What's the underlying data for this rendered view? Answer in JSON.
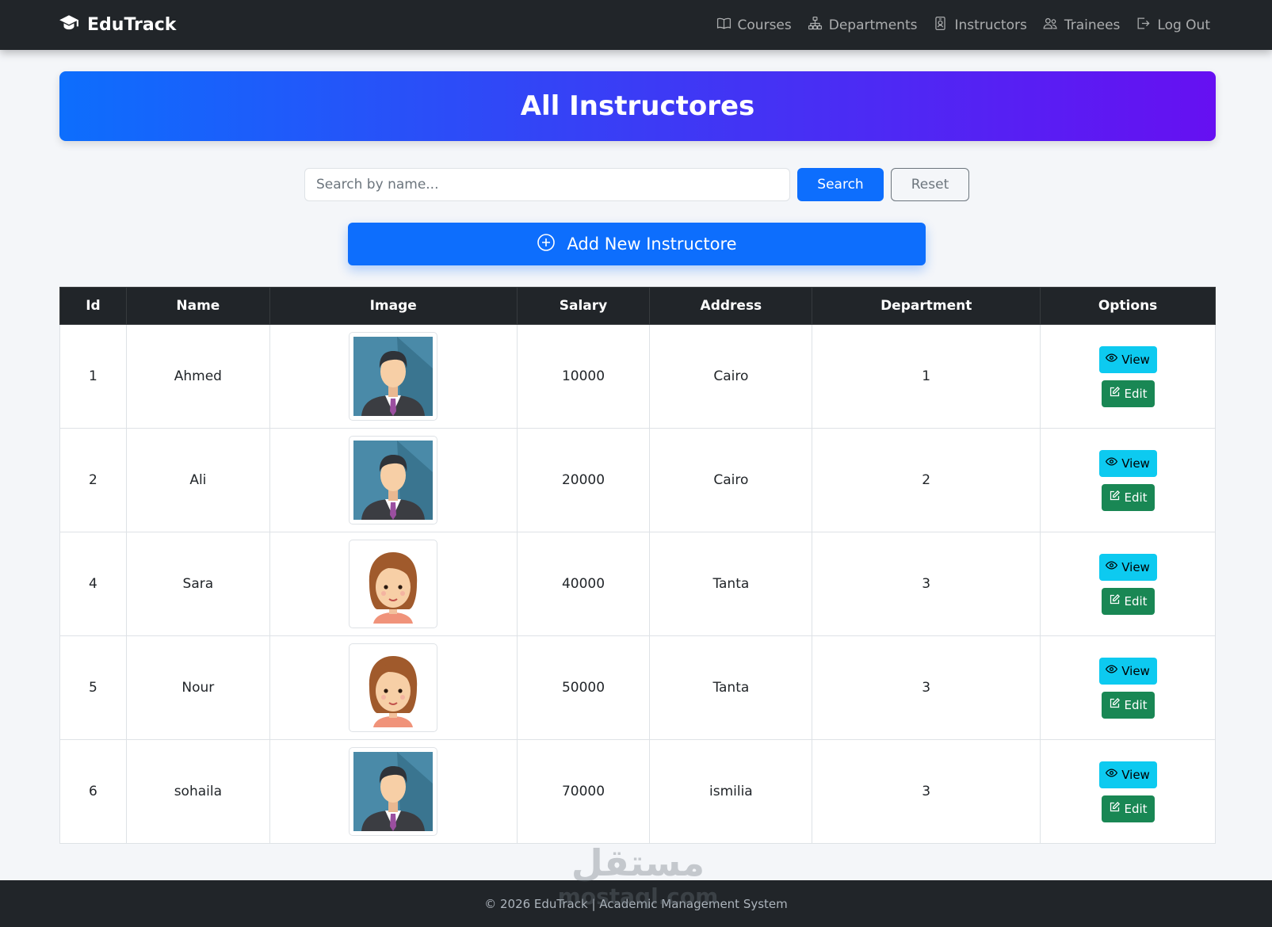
{
  "navbar": {
    "brand": "EduTrack",
    "links": [
      {
        "label": "Courses",
        "icon": "book-icon"
      },
      {
        "label": "Departments",
        "icon": "sitemap-icon"
      },
      {
        "label": "Instructors",
        "icon": "person-badge-icon"
      },
      {
        "label": "Trainees",
        "icon": "people-icon"
      },
      {
        "label": "Log Out",
        "icon": "logout-icon"
      }
    ]
  },
  "banner": {
    "title": "All Instructores"
  },
  "search": {
    "placeholder": "Search by name...",
    "value": "",
    "search_label": "Search",
    "reset_label": "Reset"
  },
  "add_button": {
    "label": "Add New Instructore"
  },
  "table": {
    "headers": [
      "Id",
      "Name",
      "Image",
      "Salary",
      "Address",
      "Department",
      "Options"
    ],
    "rows": [
      {
        "id": "1",
        "name": "Ahmed",
        "avatar": "male",
        "salary": "10000",
        "address": "Cairo",
        "department": "1"
      },
      {
        "id": "2",
        "name": "Ali",
        "avatar": "male",
        "salary": "20000",
        "address": "Cairo",
        "department": "2"
      },
      {
        "id": "4",
        "name": "Sara",
        "avatar": "female",
        "salary": "40000",
        "address": "Tanta",
        "department": "3"
      },
      {
        "id": "5",
        "name": "Nour",
        "avatar": "female",
        "salary": "50000",
        "address": "Tanta",
        "department": "3"
      },
      {
        "id": "6",
        "name": "sohaila",
        "avatar": "male",
        "salary": "70000",
        "address": "ismilia",
        "department": "3"
      }
    ],
    "view_label": "View",
    "edit_label": "Edit"
  },
  "footer": {
    "text": "© 2026 EduTrack | Academic Management System"
  },
  "watermark": {
    "text": "مستقل mostaql.com"
  },
  "colors": {
    "navbar_bg": "#212529",
    "primary": "#0d6efd",
    "banner_end": "#6610f2",
    "view_btn": "#0dcaf0",
    "edit_btn": "#198754",
    "page_bg": "#f4f6f9"
  }
}
